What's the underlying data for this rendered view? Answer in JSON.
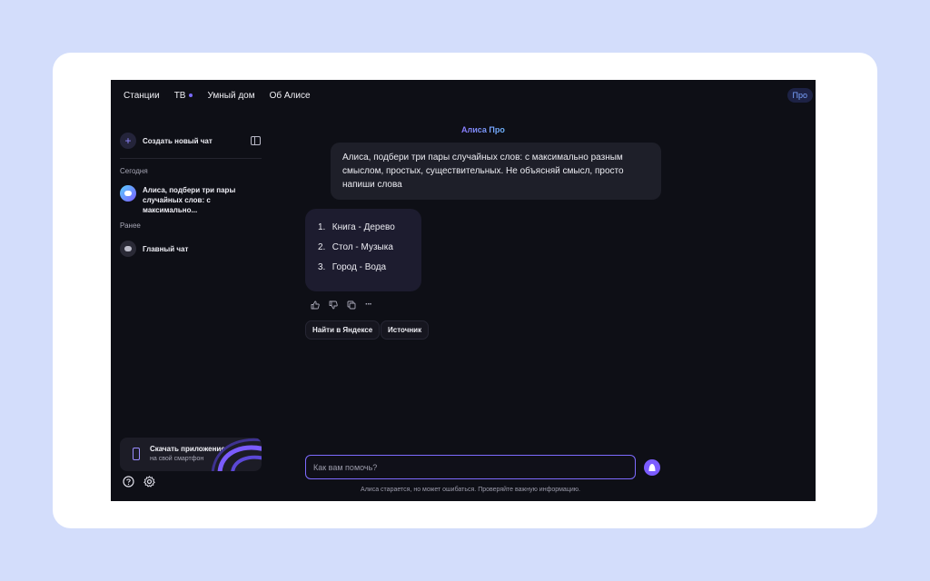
{
  "nav": {
    "items": [
      {
        "label": "Станции"
      },
      {
        "label": "ТВ"
      },
      {
        "label": "Умный дом"
      },
      {
        "label": "Об Алисе"
      }
    ],
    "pro_badge": "Про"
  },
  "sidebar": {
    "new_chat_label": "Создать новый чат",
    "today_label": "Сегодня",
    "today_chat": "Алиса, подбери три пары случайных слов: с максимально...",
    "earlier_label": "Ранее",
    "main_chat": "Главный чат",
    "promo_title": "Скачать приложение",
    "promo_subtitle": "на свой смартфон"
  },
  "chat": {
    "title": "Алиса Про",
    "user_message": "Алиса, подбери три пары случайных слов: с максимально разным смыслом, простых, существительных. Не объясняй смысл, просто напиши слова",
    "answer": [
      {
        "num": "1.",
        "text": "Книга - Дерево"
      },
      {
        "num": "2.",
        "text": "Стол - Музыка"
      },
      {
        "num": "3.",
        "text": "Город - Вода"
      }
    ],
    "chips": [
      "Найти в Яндексе",
      "Источник"
    ],
    "more_glyph": "···"
  },
  "composer": {
    "placeholder": "Как вам помочь?",
    "disclaimer": "Алиса старается, но может ошибаться. Проверяйте важную информацию."
  },
  "colors": {
    "accent": "#7b5cff",
    "background": "#0e0f16",
    "page": "#d3ddfb"
  }
}
